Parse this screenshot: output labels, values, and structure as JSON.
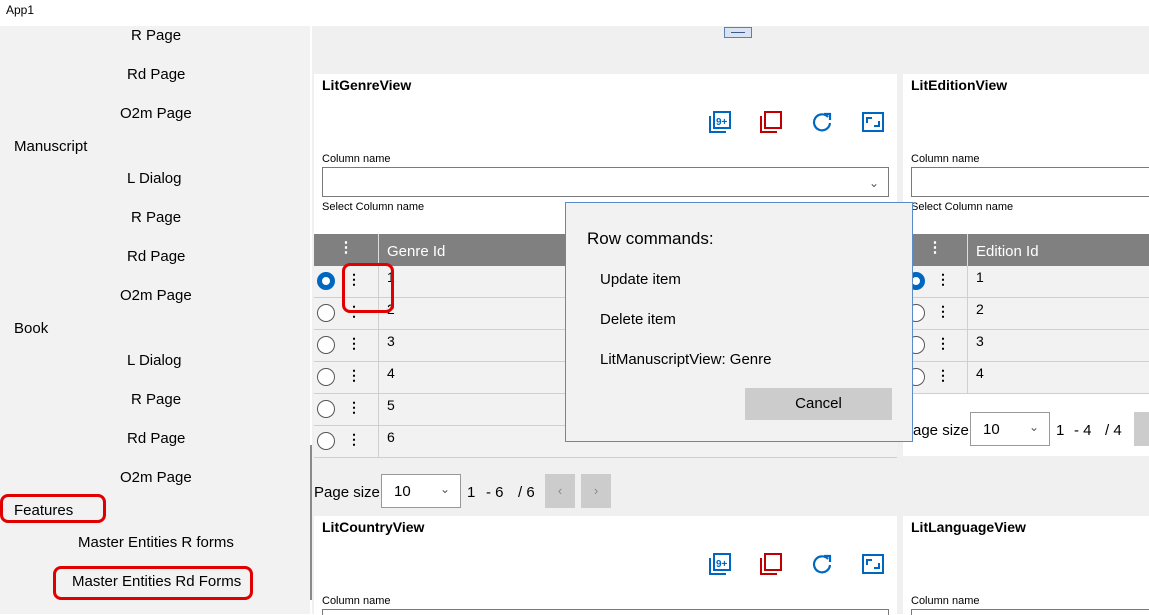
{
  "app": {
    "title": "App1"
  },
  "nav": {
    "items": [
      {
        "label": "R Page"
      },
      {
        "label": "Rd Page"
      },
      {
        "label": "O2m Page"
      },
      {
        "label": "Manuscript"
      },
      {
        "label": "L Dialog"
      },
      {
        "label": "R Page"
      },
      {
        "label": "Rd Page"
      },
      {
        "label": "O2m Page"
      },
      {
        "label": "Book"
      },
      {
        "label": "L Dialog"
      },
      {
        "label": "R Page"
      },
      {
        "label": "Rd Page"
      },
      {
        "label": "O2m Page"
      },
      {
        "label": "Features"
      },
      {
        "label": "Master Entities R forms"
      },
      {
        "label": "Master Entities Rd Forms"
      }
    ]
  },
  "genre": {
    "title": "LitGenreView",
    "column_label": "Column name",
    "column_value": "",
    "column_hint": "Select Column name",
    "header": "Genre Id",
    "rows": [
      "1",
      "2",
      "3",
      "4",
      "5",
      "6"
    ],
    "page_size_label": "Page size",
    "page_size": "10",
    "range_start": "1",
    "range_end": "- 6",
    "range_total": "/ 6"
  },
  "edition": {
    "title": "LitEditionView",
    "column_label": "Column name",
    "column_hint": "Select Column name",
    "header": "Edition Id",
    "rows": [
      "1",
      "2",
      "3",
      "4"
    ],
    "page_size_label": "age size",
    "page_size": "10",
    "range_start": "1",
    "range_end": "- 4",
    "range_total": "/ 4"
  },
  "country": {
    "title": "LitCountryView",
    "column_label": "Column name"
  },
  "language": {
    "title": "LitLanguageView",
    "column_label": "Column name"
  },
  "toolbar": {
    "icons": [
      "add-many-icon",
      "delete-icon",
      "refresh-icon",
      "expand-icon"
    ]
  },
  "flyout": {
    "title": "Row commands:",
    "items": [
      "Update item",
      "Delete item",
      "LitManuscriptView: Genre"
    ],
    "cancel": "Cancel"
  },
  "colors": {
    "accent": "#0067c0",
    "delete": "#c00000",
    "grid_header": "#808080",
    "annotation": "#e00000"
  }
}
